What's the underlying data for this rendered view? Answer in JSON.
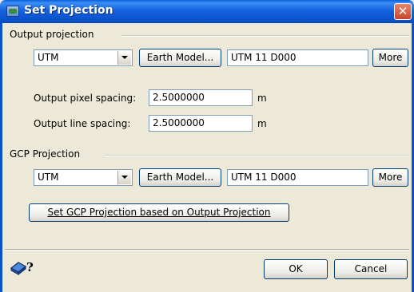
{
  "window": {
    "title": "Set Projection",
    "close_glyph": "✕"
  },
  "output_projection": {
    "group_label": "Output projection",
    "projection_value": "UTM",
    "earth_model_label": "Earth Model...",
    "projection_string": "UTM   11   D000",
    "more_label": "More",
    "pixel_spacing_label": "Output pixel spacing:",
    "pixel_spacing_value": "2.5000000",
    "pixel_spacing_unit": "m",
    "line_spacing_label": "Output line spacing:",
    "line_spacing_value": "2.5000000",
    "line_spacing_unit": "m"
  },
  "gcp_projection": {
    "group_label": "GCP Projection",
    "projection_value": "UTM",
    "earth_model_label": "Earth Model...",
    "projection_string": "UTM   11   D000",
    "more_label": "More",
    "set_from_output_label": "Set GCP Projection based on Output Projection"
  },
  "footer": {
    "ok_label": "OK",
    "cancel_label": "Cancel",
    "help_icon": "help-icon"
  }
}
